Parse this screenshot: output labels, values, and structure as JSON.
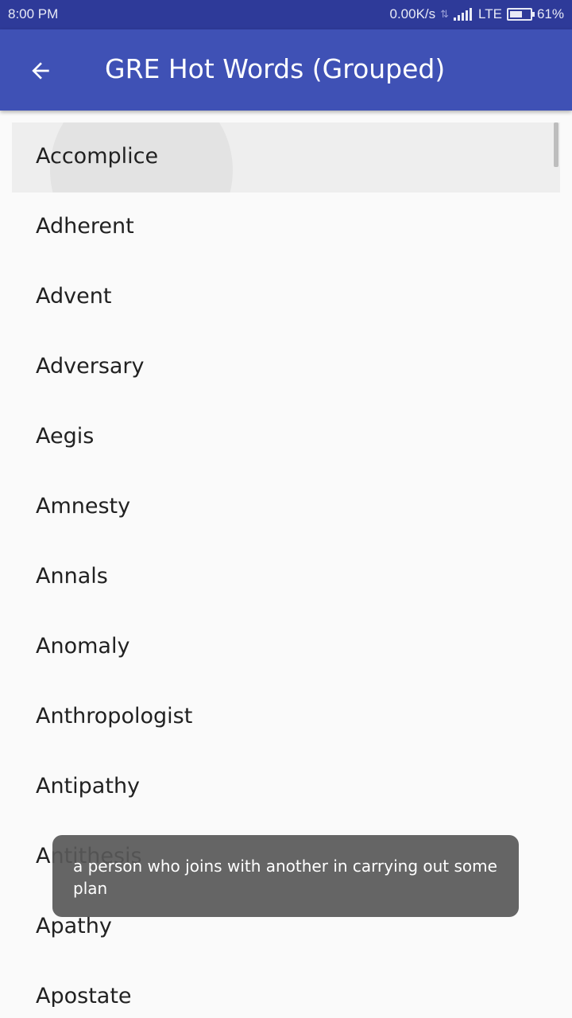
{
  "status_bar": {
    "time": "8:00 PM",
    "net_speed": "0.00K/s",
    "network_type": "LTE",
    "battery": "61%",
    "battery_level": 0.61,
    "icons": [
      "data-transfer-icon",
      "signal-icon",
      "battery-icon"
    ]
  },
  "app_bar": {
    "title": "GRE Hot Words (Grouped)",
    "back_icon": "arrow-back-icon"
  },
  "colors": {
    "status_bar": "#2e3a99",
    "app_bar": "#3f51b5",
    "background": "#fafafa",
    "toast": "#595959"
  },
  "words": [
    "Accomplice",
    "Adherent",
    "Advent",
    "Adversary",
    "Aegis",
    "Amnesty",
    "Annals",
    "Anomaly",
    "Anthropologist",
    "Antipathy",
    "Antithesis",
    "Apathy",
    "Apostate"
  ],
  "toast": {
    "message": "a person who joins with another in carrying out some plan"
  }
}
